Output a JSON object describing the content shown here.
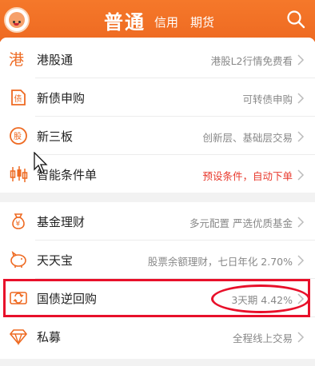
{
  "header": {
    "tab_active": "普通",
    "tab_credit": "信用",
    "tab_futures": "期货"
  },
  "section1": [
    {
      "label": "港股通",
      "desc": "港股L2行情免费看",
      "icon": "hk-char-icon"
    },
    {
      "label": "新债申购",
      "desc": "可转债申购",
      "icon": "bond-icon"
    },
    {
      "label": "新三板",
      "desc": "创新层、基础层交易",
      "icon": "stock-board-icon"
    },
    {
      "label": "智能条件单",
      "desc": "预设条件，自动下单",
      "icon": "candlestick-icon",
      "desc_color": "#e8382c"
    }
  ],
  "section2": [
    {
      "label": "基金理财",
      "desc": "多元配置 严选优质基金",
      "icon": "money-bag-icon"
    },
    {
      "label": "天天宝",
      "desc": "股票余额理财，七日年化 2.70%",
      "icon": "piggy-bank-icon"
    },
    {
      "label": "国债逆回购",
      "desc": "3天期 4.42%",
      "icon": "repo-icon"
    },
    {
      "label": "私募",
      "desc": "全程线上交易",
      "icon": "diamond-icon"
    }
  ],
  "colors": {
    "accent": "#ee6a22",
    "highlight": "#e8102a"
  }
}
